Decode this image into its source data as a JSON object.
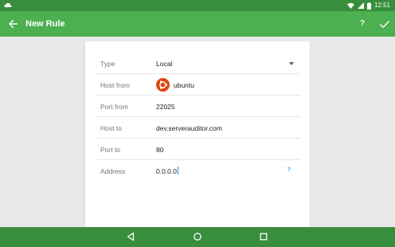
{
  "status_bar": {
    "time": "12:51",
    "left_icon": "cloud-icon",
    "icons": [
      "wifi-icon",
      "signal-icon",
      "battery-icon"
    ]
  },
  "app_bar": {
    "title": "New Rule",
    "help_label": "?",
    "back_icon": "arrow-back-icon",
    "confirm_icon": "check-icon"
  },
  "form": {
    "type": {
      "label": "Type",
      "value": "Local"
    },
    "host_from": {
      "label": "Host from",
      "value": "ubuntu",
      "icon": "ubuntu-icon"
    },
    "port_from": {
      "label": "Port from",
      "value": "22025"
    },
    "host_to": {
      "label": "Host to",
      "value": "dev.serverauditor.com"
    },
    "port_to": {
      "label": "Port to",
      "value": "80"
    },
    "address": {
      "label": "Address",
      "value": "0.0.0.0",
      "help_label": "?"
    }
  },
  "nav_bar": {
    "buttons": [
      "back-triangle-icon",
      "home-circle-icon",
      "recents-square-icon"
    ]
  },
  "colors": {
    "status_bar": "#388e3c",
    "app_bar": "#4caf50",
    "accent": "#2196f3",
    "ubuntu": "#dd4814"
  }
}
